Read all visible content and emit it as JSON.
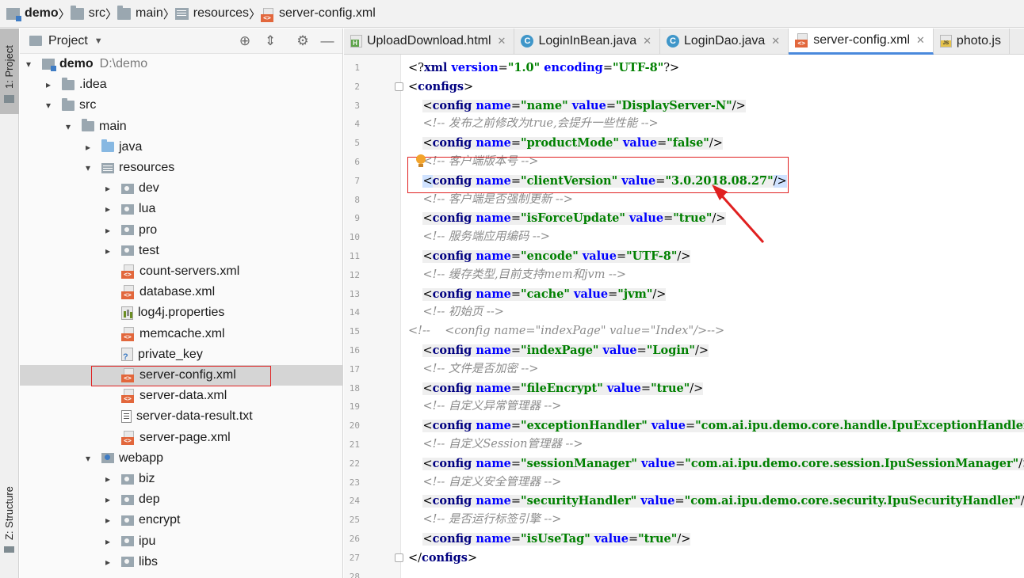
{
  "breadcrumb": [
    {
      "label": "demo",
      "bold": true,
      "icon": "module-icon"
    },
    {
      "label": "src",
      "icon": "folder-icon"
    },
    {
      "label": "main",
      "icon": "folder-icon"
    },
    {
      "label": "resources",
      "icon": "resources-folder-icon"
    },
    {
      "label": "server-config.xml",
      "icon": "xml-file-icon"
    }
  ],
  "tool_strip": {
    "project": "1: Project",
    "structure": "Z: Structure"
  },
  "project_panel": {
    "title": "Project",
    "tree": [
      {
        "label": "demo",
        "path": "D:\\demo",
        "bold": true,
        "icon": "module-icon",
        "arrow": "▾",
        "indent": 0
      },
      {
        "label": ".idea",
        "icon": "folder-icon",
        "arrow": "▸",
        "indent": 1
      },
      {
        "label": "src",
        "icon": "folder-icon",
        "arrow": "▾",
        "indent": 1
      },
      {
        "label": "main",
        "icon": "folder-icon",
        "arrow": "▾",
        "indent": 2
      },
      {
        "label": "java",
        "icon": "source-folder-icon",
        "arrow": "▸",
        "indent": 3
      },
      {
        "label": "resources",
        "icon": "resources-folder-icon",
        "arrow": "▾",
        "indent": 3
      },
      {
        "label": "dev",
        "icon": "package-icon",
        "arrow": "▸",
        "indent": 4
      },
      {
        "label": "lua",
        "icon": "package-icon",
        "arrow": "▸",
        "indent": 4
      },
      {
        "label": "pro",
        "icon": "package-icon",
        "arrow": "▸",
        "indent": 4
      },
      {
        "label": "test",
        "icon": "package-icon",
        "arrow": "▸",
        "indent": 4
      },
      {
        "label": "count-servers.xml",
        "icon": "xml-file-icon",
        "arrow": "",
        "indent": 4
      },
      {
        "label": "database.xml",
        "icon": "xml-file-icon",
        "arrow": "",
        "indent": 4
      },
      {
        "label": "log4j.properties",
        "icon": "properties-file-icon",
        "arrow": "",
        "indent": 4
      },
      {
        "label": "memcache.xml",
        "icon": "xml-file-icon",
        "arrow": "",
        "indent": 4
      },
      {
        "label": "private_key",
        "icon": "unknown-file-icon",
        "arrow": "",
        "indent": 4
      },
      {
        "label": "server-config.xml",
        "icon": "xml-file-icon",
        "arrow": "",
        "indent": 4,
        "selected": true
      },
      {
        "label": "server-data.xml",
        "icon": "xml-file-icon",
        "arrow": "",
        "indent": 4
      },
      {
        "label": "server-data-result.txt",
        "icon": "text-file-icon",
        "arrow": "",
        "indent": 4
      },
      {
        "label": "server-page.xml",
        "icon": "xml-file-icon",
        "arrow": "",
        "indent": 4
      },
      {
        "label": "webapp",
        "icon": "webapp-folder-icon",
        "arrow": "▾",
        "indent": 3
      },
      {
        "label": "biz",
        "icon": "package-icon",
        "arrow": "▸",
        "indent": 4
      },
      {
        "label": "dep",
        "icon": "package-icon",
        "arrow": "▸",
        "indent": 4
      },
      {
        "label": "encrypt",
        "icon": "package-icon",
        "arrow": "▸",
        "indent": 4
      },
      {
        "label": "ipu",
        "icon": "package-icon",
        "arrow": "▸",
        "indent": 4
      },
      {
        "label": "libs",
        "icon": "package-icon",
        "arrow": "▸",
        "indent": 4
      }
    ]
  },
  "tabs": [
    {
      "label": "UploadDownload.html",
      "icon": "html-file-icon",
      "active": false
    },
    {
      "label": "LoginInBean.java",
      "icon": "java-class-icon",
      "active": false
    },
    {
      "label": "LoginDao.java",
      "icon": "java-class-icon",
      "active": false
    },
    {
      "label": "server-config.xml",
      "icon": "xml-file-icon",
      "active": true
    },
    {
      "label": "photo.js",
      "icon": "js-file-icon",
      "active": false
    }
  ],
  "editor": {
    "lines": [
      {
        "n": "1",
        "indent": 0,
        "tokens": [
          [
            "punc",
            "<?"
          ],
          [
            "kw",
            "xml "
          ],
          [
            "attr",
            "version"
          ],
          [
            "punc",
            "="
          ],
          [
            "val",
            "\"1.0\" "
          ],
          [
            "attr",
            "encoding"
          ],
          [
            "punc",
            "="
          ],
          [
            "val",
            "\"UTF-8\""
          ],
          [
            "punc",
            "?>"
          ]
        ]
      },
      {
        "n": "2",
        "indent": 0,
        "tokens": [
          [
            "punc",
            "<"
          ],
          [
            "kw",
            "configs"
          ],
          [
            "punc",
            ">"
          ]
        ]
      },
      {
        "n": "3",
        "indent": 1,
        "tokens": [
          [
            "punc",
            "<"
          ],
          [
            "kw",
            "config "
          ],
          [
            "attr",
            "name"
          ],
          [
            "punc",
            "="
          ],
          [
            "val",
            "\"name\" "
          ],
          [
            "attr",
            "value"
          ],
          [
            "punc",
            "="
          ],
          [
            "val",
            "\"DisplayServer-N\""
          ],
          [
            "punc",
            "/>"
          ]
        ]
      },
      {
        "n": "4",
        "indent": 1,
        "tokens": [
          [
            "cmt",
            "<!-- 发布之前修改为true,会提升一些性能 -->"
          ]
        ]
      },
      {
        "n": "5",
        "indent": 1,
        "tokens": [
          [
            "punc",
            "<"
          ],
          [
            "kw",
            "config "
          ],
          [
            "attr",
            "name"
          ],
          [
            "punc",
            "="
          ],
          [
            "val",
            "\"productMode\" "
          ],
          [
            "attr",
            "value"
          ],
          [
            "punc",
            "="
          ],
          [
            "val",
            "\"false\""
          ],
          [
            "punc",
            "/>"
          ]
        ]
      },
      {
        "n": "6",
        "indent": 1,
        "tokens": [
          [
            "cmt",
            "<!-- 客户端版本号 -->"
          ]
        ]
      },
      {
        "n": "7",
        "indent": 1,
        "tokens": [
          [
            "punc",
            "<"
          ],
          [
            "kw",
            "config "
          ],
          [
            "attr",
            "name"
          ],
          [
            "punc",
            "="
          ],
          [
            "val",
            "\"clientVersion\" "
          ],
          [
            "attr",
            "value"
          ],
          [
            "punc",
            "="
          ],
          [
            "val",
            "\"3.0.2018.08.27\""
          ],
          [
            "punc",
            "/>"
          ]
        ]
      },
      {
        "n": "8",
        "indent": 1,
        "tokens": [
          [
            "cmt",
            "<!-- 客户端是否强制更新 -->"
          ]
        ]
      },
      {
        "n": "9",
        "indent": 1,
        "tokens": [
          [
            "punc",
            "<"
          ],
          [
            "kw",
            "config "
          ],
          [
            "attr",
            "name"
          ],
          [
            "punc",
            "="
          ],
          [
            "val",
            "\"isForceUpdate\" "
          ],
          [
            "attr",
            "value"
          ],
          [
            "punc",
            "="
          ],
          [
            "val",
            "\"true\""
          ],
          [
            "punc",
            "/>"
          ]
        ]
      },
      {
        "n": "10",
        "indent": 1,
        "tokens": [
          [
            "cmt",
            "<!-- 服务端应用编码 -->"
          ]
        ]
      },
      {
        "n": "11",
        "indent": 1,
        "tokens": [
          [
            "punc",
            "<"
          ],
          [
            "kw",
            "config "
          ],
          [
            "attr",
            "name"
          ],
          [
            "punc",
            "="
          ],
          [
            "val",
            "\"encode\" "
          ],
          [
            "attr",
            "value"
          ],
          [
            "punc",
            "="
          ],
          [
            "val",
            "\"UTF-8\""
          ],
          [
            "punc",
            "/>"
          ]
        ]
      },
      {
        "n": "12",
        "indent": 1,
        "tokens": [
          [
            "cmt",
            "<!-- 缓存类型,目前支持mem和jvm -->"
          ]
        ]
      },
      {
        "n": "13",
        "indent": 1,
        "tokens": [
          [
            "punc",
            "<"
          ],
          [
            "kw",
            "config "
          ],
          [
            "attr",
            "name"
          ],
          [
            "punc",
            "="
          ],
          [
            "val",
            "\"cache\" "
          ],
          [
            "attr",
            "value"
          ],
          [
            "punc",
            "="
          ],
          [
            "val",
            "\"jvm\""
          ],
          [
            "punc",
            "/>"
          ]
        ]
      },
      {
        "n": "14",
        "indent": 1,
        "tokens": [
          [
            "cmt",
            "<!-- 初始页 -->"
          ]
        ]
      },
      {
        "n": "15",
        "indent": 0,
        "tokens": [
          [
            "cmt",
            "<!--    <config name=\"indexPage\" value=\"Index\"/>-->"
          ]
        ]
      },
      {
        "n": "16",
        "indent": 1,
        "tokens": [
          [
            "punc",
            "<"
          ],
          [
            "kw",
            "config "
          ],
          [
            "attr",
            "name"
          ],
          [
            "punc",
            "="
          ],
          [
            "val",
            "\"indexPage\" "
          ],
          [
            "attr",
            "value"
          ],
          [
            "punc",
            "="
          ],
          [
            "val",
            "\"Login\""
          ],
          [
            "punc",
            "/>"
          ]
        ]
      },
      {
        "n": "17",
        "indent": 1,
        "tokens": [
          [
            "cmt",
            "<!-- 文件是否加密 -->"
          ]
        ]
      },
      {
        "n": "18",
        "indent": 1,
        "tokens": [
          [
            "punc",
            "<"
          ],
          [
            "kw",
            "config "
          ],
          [
            "attr",
            "name"
          ],
          [
            "punc",
            "="
          ],
          [
            "val",
            "\"fileEncrypt\" "
          ],
          [
            "attr",
            "value"
          ],
          [
            "punc",
            "="
          ],
          [
            "val",
            "\"true\""
          ],
          [
            "punc",
            "/>"
          ]
        ]
      },
      {
        "n": "19",
        "indent": 1,
        "tokens": [
          [
            "cmt",
            "<!-- 自定义异常管理器 -->"
          ]
        ]
      },
      {
        "n": "20",
        "indent": 1,
        "tokens": [
          [
            "punc",
            "<"
          ],
          [
            "kw",
            "config "
          ],
          [
            "attr",
            "name"
          ],
          [
            "punc",
            "="
          ],
          [
            "val",
            "\"exceptionHandler\" "
          ],
          [
            "attr",
            "value"
          ],
          [
            "punc",
            "="
          ],
          [
            "val",
            "\"com.ai.ipu.demo.core.handle.IpuExceptionHandler\""
          ],
          [
            "punc",
            "/>"
          ]
        ]
      },
      {
        "n": "21",
        "indent": 1,
        "tokens": [
          [
            "cmt",
            "<!-- 自定义Session管理器 -->"
          ]
        ]
      },
      {
        "n": "22",
        "indent": 1,
        "tokens": [
          [
            "punc",
            "<"
          ],
          [
            "kw",
            "config "
          ],
          [
            "attr",
            "name"
          ],
          [
            "punc",
            "="
          ],
          [
            "val",
            "\"sessionManager\" "
          ],
          [
            "attr",
            "value"
          ],
          [
            "punc",
            "="
          ],
          [
            "val",
            "\"com.ai.ipu.demo.core.session.IpuSessionManager\""
          ],
          [
            "punc",
            "/>"
          ]
        ]
      },
      {
        "n": "23",
        "indent": 1,
        "tokens": [
          [
            "cmt",
            "<!-- 自定义安全管理器 -->"
          ]
        ]
      },
      {
        "n": "24",
        "indent": 1,
        "tokens": [
          [
            "punc",
            "<"
          ],
          [
            "kw",
            "config "
          ],
          [
            "attr",
            "name"
          ],
          [
            "punc",
            "="
          ],
          [
            "val",
            "\"securityHandler\" "
          ],
          [
            "attr",
            "value"
          ],
          [
            "punc",
            "="
          ],
          [
            "val",
            "\"com.ai.ipu.demo.core.security.IpuSecurityHandler\""
          ],
          [
            "punc",
            "/>"
          ]
        ]
      },
      {
        "n": "25",
        "indent": 1,
        "tokens": [
          [
            "cmt",
            "<!-- 是否运行标签引擎 -->"
          ]
        ]
      },
      {
        "n": "26",
        "indent": 1,
        "tokens": [
          [
            "punc",
            "<"
          ],
          [
            "kw",
            "config "
          ],
          [
            "attr",
            "name"
          ],
          [
            "punc",
            "="
          ],
          [
            "val",
            "\"isUseTag\" "
          ],
          [
            "attr",
            "value"
          ],
          [
            "punc",
            "="
          ],
          [
            "val",
            "\"true\""
          ],
          [
            "punc",
            "/>"
          ]
        ]
      },
      {
        "n": "27",
        "indent": 0,
        "tokens": [
          [
            "punc",
            "</"
          ],
          [
            "kw",
            "configs"
          ],
          [
            "punc",
            ">"
          ]
        ]
      },
      {
        "n": "28",
        "indent": 0,
        "tokens": []
      }
    ]
  },
  "colors": {
    "keyword": "#000080",
    "attribute": "#0000ff",
    "value": "#008000",
    "comment": "#8c8c8c",
    "annotation": "#e02020"
  }
}
